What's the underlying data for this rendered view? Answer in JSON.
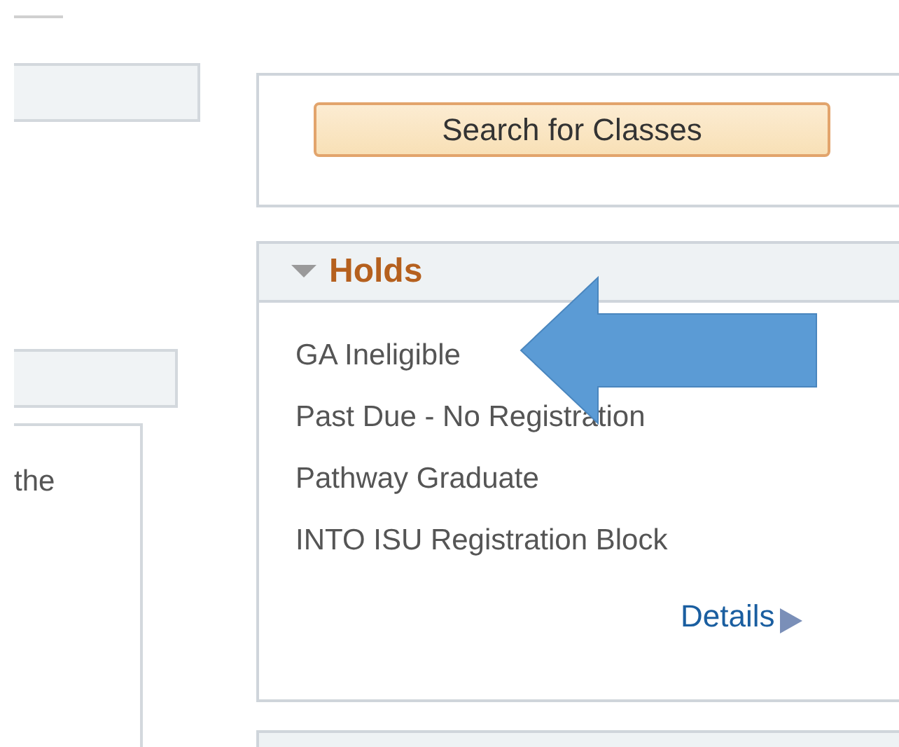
{
  "left_panel": {
    "text": "the"
  },
  "search_button": {
    "label": "Search for Classes"
  },
  "holds": {
    "title": "Holds",
    "expanded": true,
    "items": [
      "GA Ineligible",
      "Past Due - No Registration",
      "Pathway Graduate",
      "INTO ISU Registration Block"
    ],
    "details_link": "Details"
  }
}
